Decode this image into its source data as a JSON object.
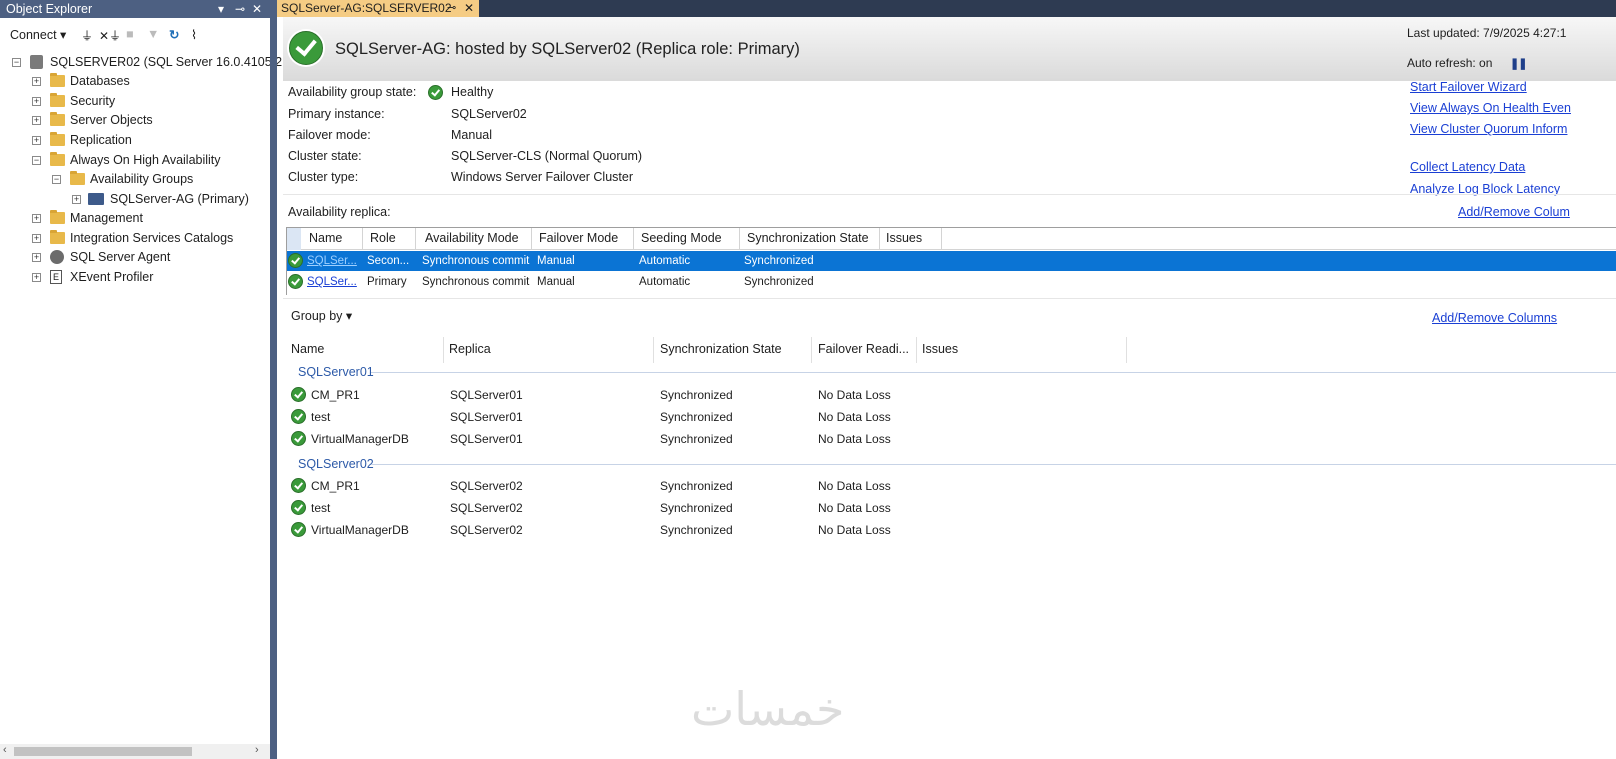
{
  "object_explorer": {
    "title": "Object Explorer",
    "title_controls": [
      "▾",
      "📌",
      "✕"
    ],
    "connect_label": "Connect ▾",
    "toolbar_icons": [
      "connect-object-explorer-icon",
      "disconnect-icon",
      "stop-icon",
      "filter-icon",
      "refresh-icon",
      "activity-monitor-icon"
    ],
    "tree": [
      {
        "label": "SQLSERVER02 (SQL Server 16.0.4105.2 -",
        "icon": "server-icon",
        "expander": "⊟"
      },
      {
        "label": "Databases",
        "icon": "folder-icon",
        "expander": "⊞"
      },
      {
        "label": "Security",
        "icon": "folder-icon",
        "expander": "⊞"
      },
      {
        "label": "Server Objects",
        "icon": "folder-icon",
        "expander": "⊞"
      },
      {
        "label": "Replication",
        "icon": "folder-icon",
        "expander": "⊞"
      },
      {
        "label": "Always On High Availability",
        "icon": "folder-icon",
        "expander": "⊟"
      },
      {
        "label": "Availability Groups",
        "icon": "folder-icon",
        "expander": "⊟"
      },
      {
        "label": "SQLServer-AG (Primary)",
        "icon": "availability-group-icon",
        "expander": "⊞"
      },
      {
        "label": "Management",
        "icon": "folder-icon",
        "expander": "⊞"
      },
      {
        "label": "Integration Services Catalogs",
        "icon": "folder-icon",
        "expander": "⊞"
      },
      {
        "label": "SQL Server Agent",
        "icon": "agent-icon",
        "expander": "⊞"
      },
      {
        "label": "XEvent Profiler",
        "icon": "xevent-icon",
        "expander": "⊞"
      }
    ]
  },
  "tab": {
    "label": "SQLServer-AG:SQLSERVER02",
    "pin": "⊸",
    "close": "✕"
  },
  "header": {
    "title": "SQLServer-AG: hosted by SQLServer02 (Replica role: Primary)",
    "last_updated": "Last updated: 7/9/2025 4:27:1",
    "auto_refresh": "Auto refresh: on",
    "pause": "❚❚"
  },
  "properties": [
    {
      "label": "Availability group state:",
      "value": "Healthy"
    },
    {
      "label": "Primary instance:",
      "value": "SQLServer02"
    },
    {
      "label": "Failover mode:",
      "value": "Manual"
    },
    {
      "label": "Cluster state:",
      "value": "SQLServer-CLS (Normal Quorum)"
    },
    {
      "label": "Cluster type:",
      "value": "Windows Server Failover Cluster"
    }
  ],
  "links": {
    "start_failover": "Start Failover Wizard",
    "view_health": "View Always On Health Even",
    "view_quorum": "View Cluster Quorum Inform",
    "collect_latency": "Collect Latency Data",
    "analyze_latency": "Analyze Log Block Latency",
    "add_remove_top": "Add/Remove Colum",
    "add_remove_bottom": "Add/Remove Columns"
  },
  "replica_section": {
    "label": "Availability replica:",
    "columns": [
      "Name",
      "Role",
      "Availability Mode",
      "Failover Mode",
      "Seeding Mode",
      "Synchronization State",
      "Issues"
    ],
    "rows": [
      {
        "name": "SQLSer...",
        "role": "Secon...",
        "availability_mode": "Synchronous commit",
        "failover_mode": "Manual",
        "seeding_mode": "Automatic",
        "sync_state": "Synchronized",
        "issues": "",
        "selected": true
      },
      {
        "name": "SQLSer...",
        "role": "Primary",
        "availability_mode": "Synchronous commit",
        "failover_mode": "Manual",
        "seeding_mode": "Automatic",
        "sync_state": "Synchronized",
        "issues": "",
        "selected": false
      }
    ]
  },
  "database_section": {
    "group_by": "Group by ▾",
    "columns": [
      "Name",
      "Replica",
      "Synchronization State",
      "Failover Readi...",
      "Issues"
    ],
    "groups": [
      {
        "name": "SQLServer01",
        "rows": [
          {
            "name": "CM_PR1",
            "replica": "SQLServer01",
            "sync_state": "Synchronized",
            "failover": "No Data Loss"
          },
          {
            "name": "test",
            "replica": "SQLServer01",
            "sync_state": "Synchronized",
            "failover": "No Data Loss"
          },
          {
            "name": "VirtualManagerDB",
            "replica": "SQLServer01",
            "sync_state": "Synchronized",
            "failover": "No Data Loss"
          }
        ]
      },
      {
        "name": "SQLServer02",
        "rows": [
          {
            "name": "CM_PR1",
            "replica": "SQLServer02",
            "sync_state": "Synchronized",
            "failover": "No Data Loss"
          },
          {
            "name": "test",
            "replica": "SQLServer02",
            "sync_state": "Synchronized",
            "failover": "No Data Loss"
          },
          {
            "name": "VirtualManagerDB",
            "replica": "SQLServer02",
            "sync_state": "Synchronized",
            "failover": "No Data Loss"
          }
        ]
      }
    ]
  },
  "watermark": "خمسات",
  "colors": {
    "accent": "#4d6082",
    "tab": "#f5cc84",
    "selection": "#0b74d4",
    "link": "#1a3fd4",
    "healthy": "#3a9a3a"
  }
}
